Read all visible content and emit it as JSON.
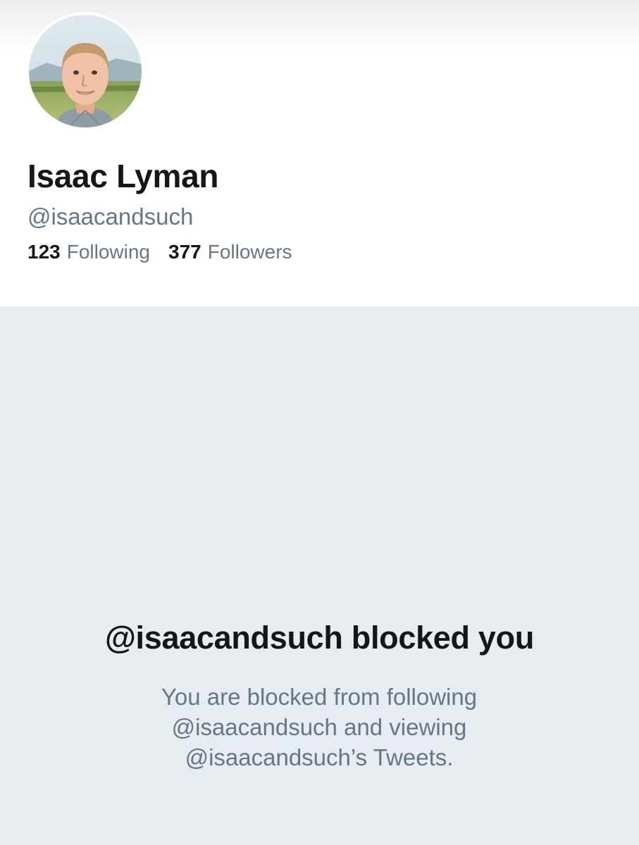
{
  "profile": {
    "display_name": "Isaac Lyman",
    "handle": "@isaacandsuch",
    "avatar_icon": "profile-photo",
    "stats": {
      "following_count": "123",
      "following_label": "Following",
      "followers_count": "377",
      "followers_label": "Followers"
    }
  },
  "blocked": {
    "title": "@isaacandsuch blocked you",
    "message_lines": [
      "You are blocked from following",
      "@isaacandsuch and viewing",
      "@isaacandsuch’s Tweets."
    ]
  },
  "colors": {
    "text_primary": "#14171a",
    "text_secondary": "#657786",
    "blocked_background": "#e6ecf0"
  }
}
